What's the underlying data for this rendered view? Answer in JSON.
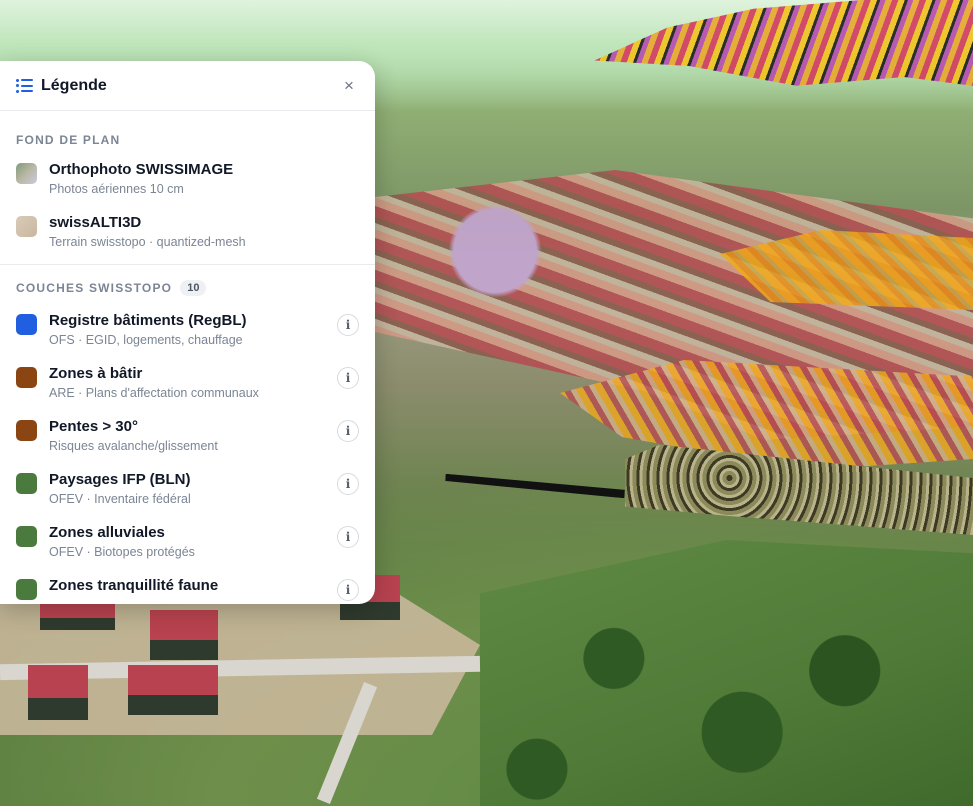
{
  "legend": {
    "title": "Légende",
    "close_symbol": "×",
    "basemap_section": {
      "label": "FOND DE PLAN",
      "items": [
        {
          "name": "Orthophoto SWISSIMAGE",
          "subtitle": "Photos aériennes 10 cm",
          "swatch": "linear-gradient(135deg,#8aa07a,#c9c9d6)"
        },
        {
          "name": "swissALTI3D",
          "subtitle": "Terrain swisstopo · quantized-mesh",
          "swatch": "#d8c8b4"
        }
      ]
    },
    "layers_section": {
      "label": "COUCHES SWISSTOPO",
      "count": "10",
      "items": [
        {
          "name": "Registre bâtiments (RegBL)",
          "subtitle": "OFS · EGID, logements, chauffage",
          "color": "#1f5fe0",
          "info": "i"
        },
        {
          "name": "Zones à bâtir",
          "subtitle": "ARE · Plans d'affectation communaux",
          "color": "#8b4513",
          "info": "i"
        },
        {
          "name": "Pentes > 30°",
          "subtitle": "Risques avalanche/glissement",
          "color": "#8b4513",
          "info": "i"
        },
        {
          "name": "Paysages IFP (BLN)",
          "subtitle": "OFEV · Inventaire fédéral",
          "color": "#4a7a3d",
          "info": "i"
        },
        {
          "name": "Zones alluviales",
          "subtitle": "OFEV · Biotopes protégés",
          "color": "#4a7a3d",
          "info": "i"
        },
        {
          "name": "Zones tranquillité faune",
          "subtitle": "",
          "color": "#4a7a3d",
          "info": "i"
        }
      ]
    }
  },
  "icons": {
    "legend": "list-icon",
    "close": "close-icon",
    "info": "info-icon"
  },
  "colors": {
    "accent": "#1f5fe0",
    "building_roof": "#b8424f",
    "zone_orange": "#f2a91b"
  }
}
